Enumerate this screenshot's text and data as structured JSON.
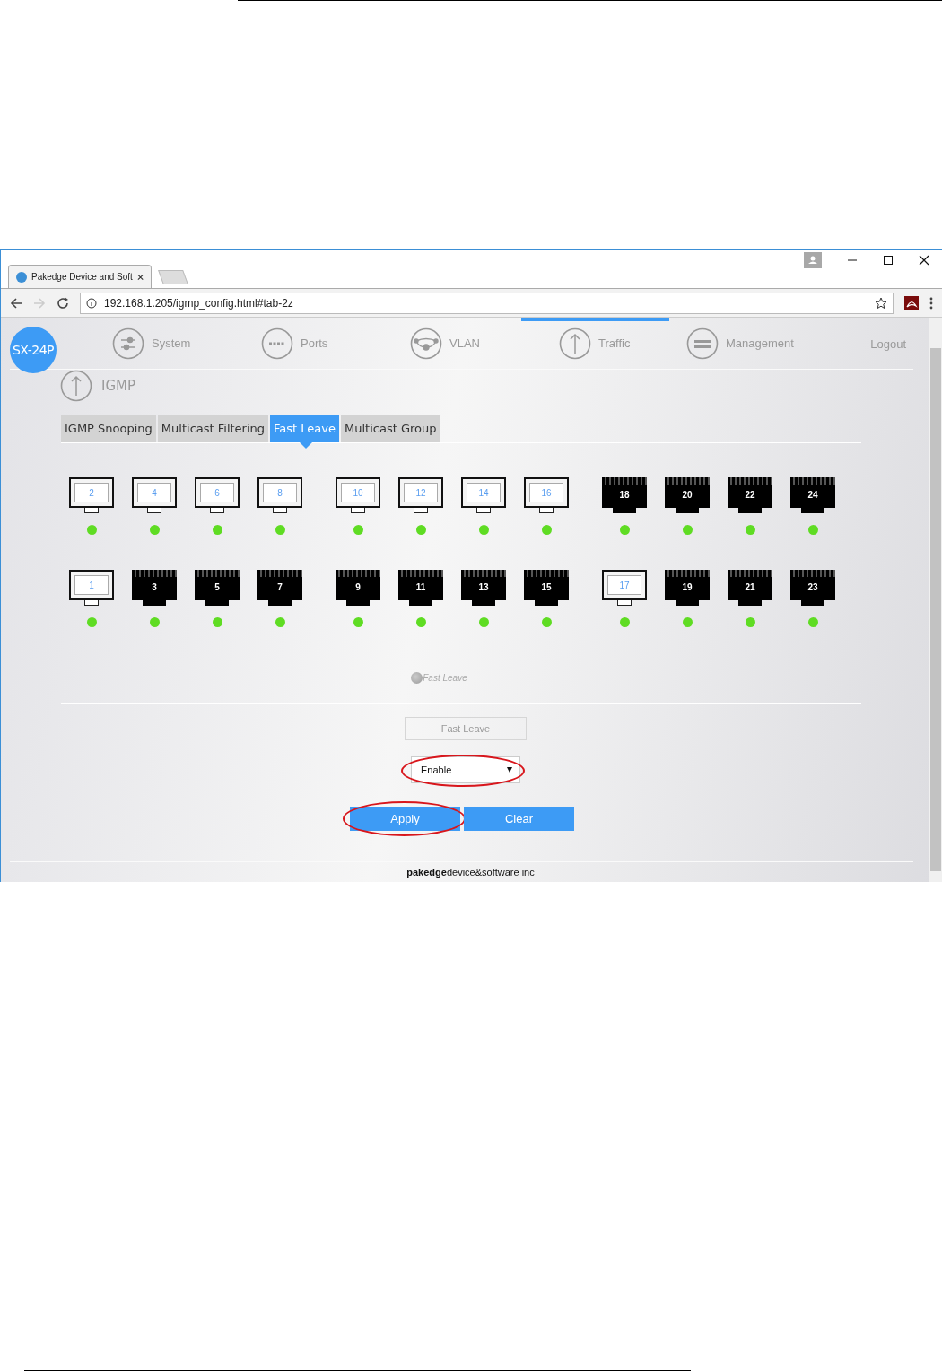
{
  "browser": {
    "tab_title": "Pakedge Device and Soft",
    "url": "192.168.1.205/igmp_config.html#tab-2z"
  },
  "logo": "SX-24P",
  "nav": [
    {
      "label": "System",
      "kind": "sliders",
      "selected": false
    },
    {
      "label": "Ports",
      "kind": "dots",
      "selected": false
    },
    {
      "label": "VLAN",
      "kind": "network",
      "selected": false
    },
    {
      "label": "Traffic",
      "kind": "arrow",
      "selected": true
    },
    {
      "label": "Management",
      "kind": "bars",
      "selected": false
    }
  ],
  "logout": "Logout",
  "section": "IGMP",
  "tabs": [
    {
      "label": "IGMP Snooping",
      "selected": false
    },
    {
      "label": "Multicast Filtering",
      "selected": false
    },
    {
      "label": "Fast Leave",
      "selected": true
    },
    {
      "label": "Multicast Group",
      "selected": false
    }
  ],
  "port_rows": [
    [
      {
        "number": "2",
        "selected": true,
        "link": true
      },
      {
        "number": "4",
        "selected": true,
        "link": true
      },
      {
        "number": "6",
        "selected": true,
        "link": true
      },
      {
        "number": "8",
        "selected": true,
        "link": true
      },
      {
        "number": "10",
        "selected": true,
        "link": true
      },
      {
        "number": "12",
        "selected": true,
        "link": true
      },
      {
        "number": "14",
        "selected": true,
        "link": true
      },
      {
        "number": "16",
        "selected": true,
        "link": true
      },
      {
        "number": "18",
        "selected": false,
        "link": true
      },
      {
        "number": "20",
        "selected": false,
        "link": true
      },
      {
        "number": "22",
        "selected": false,
        "link": true
      },
      {
        "number": "24",
        "selected": false,
        "link": true
      }
    ],
    [
      {
        "number": "1",
        "selected": true,
        "link": true
      },
      {
        "number": "3",
        "selected": false,
        "link": true
      },
      {
        "number": "5",
        "selected": false,
        "link": true
      },
      {
        "number": "7",
        "selected": false,
        "link": true
      },
      {
        "number": "9",
        "selected": false,
        "link": true
      },
      {
        "number": "11",
        "selected": false,
        "link": true
      },
      {
        "number": "13",
        "selected": false,
        "link": true
      },
      {
        "number": "15",
        "selected": false,
        "link": true
      },
      {
        "number": "17",
        "selected": true,
        "link": true
      },
      {
        "number": "19",
        "selected": false,
        "link": true
      },
      {
        "number": "21",
        "selected": false,
        "link": true
      },
      {
        "number": "23",
        "selected": false,
        "link": true
      }
    ]
  ],
  "legend": "Fast Leave",
  "field_label": "Fast Leave",
  "select": {
    "value": "Enable",
    "highlighted": true
  },
  "buttons": [
    {
      "label": "Apply",
      "highlighted": true
    },
    {
      "label": "Clear",
      "highlighted": false
    }
  ],
  "footer": "**pakedge**device&software inc"
}
